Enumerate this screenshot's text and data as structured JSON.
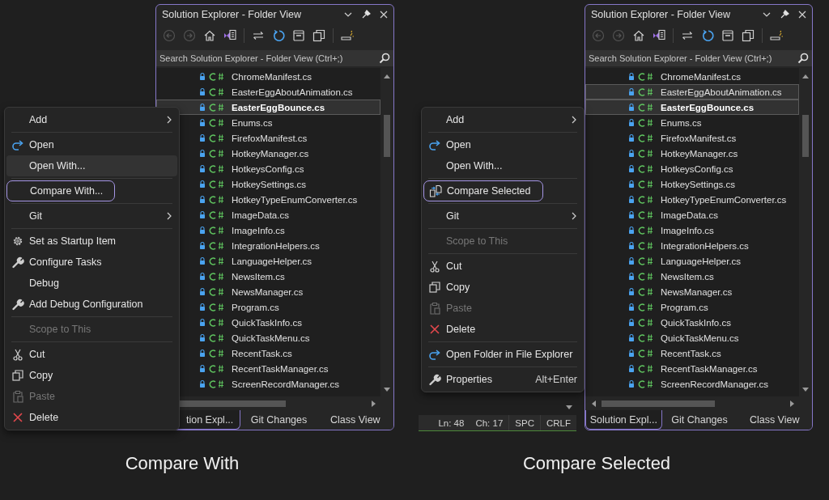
{
  "scenes": [
    {
      "panel": {
        "title": "Solution Explorer - Folder View",
        "search": {
          "placeholder": "Search Solution Explorer - Folder View (Ctrl+;)"
        },
        "files": [
          {
            "name": "ChromeManifest.cs",
            "selected": false,
            "current": false
          },
          {
            "name": "EasterEggAboutAnimation.cs",
            "selected": false,
            "current": false
          },
          {
            "name": "EasterEggBounce.cs",
            "selected": true,
            "current": true
          },
          {
            "name": "Enums.cs",
            "selected": false,
            "current": false
          },
          {
            "name": "FirefoxManifest.cs",
            "selected": false,
            "current": false
          },
          {
            "name": "HotkeyManager.cs",
            "selected": false,
            "current": false
          },
          {
            "name": "HotkeysConfig.cs",
            "selected": false,
            "current": false
          },
          {
            "name": "HotkeySettings.cs",
            "selected": false,
            "current": false
          },
          {
            "name": "HotkeyTypeEnumConverter.cs",
            "selected": false,
            "current": false
          },
          {
            "name": "ImageData.cs",
            "selected": false,
            "current": false
          },
          {
            "name": "ImageInfo.cs",
            "selected": false,
            "current": false
          },
          {
            "name": "IntegrationHelpers.cs",
            "selected": false,
            "current": false
          },
          {
            "name": "LanguageHelper.cs",
            "selected": false,
            "current": false
          },
          {
            "name": "NewsItem.cs",
            "selected": false,
            "current": false
          },
          {
            "name": "NewsManager.cs",
            "selected": false,
            "current": false
          },
          {
            "name": "Program.cs",
            "selected": false,
            "current": false
          },
          {
            "name": "QuickTaskInfo.cs",
            "selected": false,
            "current": false
          },
          {
            "name": "QuickTaskMenu.cs",
            "selected": false,
            "current": false
          },
          {
            "name": "RecentTask.cs",
            "selected": false,
            "current": false
          },
          {
            "name": "RecentTaskManager.cs",
            "selected": false,
            "current": false
          },
          {
            "name": "ScreenRecordManager.cs",
            "selected": false,
            "current": false
          }
        ],
        "tabs": [
          {
            "label": "tion Expl...",
            "selected": true
          },
          {
            "label": "Git Changes",
            "selected": false
          },
          {
            "label": "Class View",
            "selected": false
          }
        ]
      },
      "context_menu": {
        "items": [
          {
            "kind": "item",
            "label": "Add",
            "submenu": true,
            "disabled": false,
            "selected": false,
            "outlined": false
          },
          {
            "kind": "separator"
          },
          {
            "kind": "redo",
            "label": "Open",
            "submenu": false,
            "disabled": false,
            "selected": false,
            "outlined": false
          },
          {
            "kind": "item",
            "label": "Open With...",
            "submenu": false,
            "disabled": false,
            "selected": true,
            "outlined": false
          },
          {
            "kind": "separator"
          },
          {
            "kind": "item",
            "label": "Compare With...",
            "submenu": false,
            "disabled": false,
            "selected": false,
            "outlined": true
          },
          {
            "kind": "separator"
          },
          {
            "kind": "item",
            "label": "Git",
            "submenu": true,
            "disabled": false,
            "selected": false,
            "outlined": false
          },
          {
            "kind": "separator"
          },
          {
            "kind": "gear",
            "label": "Set as Startup Item",
            "submenu": false,
            "disabled": false,
            "selected": false,
            "outlined": false
          },
          {
            "kind": "wrench",
            "label": "Configure Tasks",
            "submenu": false,
            "disabled": false,
            "selected": false,
            "outlined": false
          },
          {
            "kind": "item",
            "label": "Debug",
            "submenu": false,
            "disabled": false,
            "selected": false,
            "outlined": false
          },
          {
            "kind": "wrench",
            "label": "Add Debug Configuration",
            "submenu": false,
            "disabled": false,
            "selected": false,
            "outlined": false
          },
          {
            "kind": "separator"
          },
          {
            "kind": "item",
            "label": "Scope to This",
            "submenu": false,
            "disabled": true,
            "selected": false,
            "outlined": false
          },
          {
            "kind": "separator"
          },
          {
            "kind": "scissors",
            "label": "Cut",
            "submenu": false,
            "disabled": false,
            "selected": false,
            "outlined": false
          },
          {
            "kind": "copy",
            "label": "Copy",
            "submenu": false,
            "disabled": false,
            "selected": false,
            "outlined": false
          },
          {
            "kind": "paste",
            "label": "Paste",
            "submenu": false,
            "disabled": true,
            "selected": false,
            "outlined": false
          },
          {
            "kind": "delete",
            "label": "Delete",
            "submenu": false,
            "disabled": false,
            "selected": false,
            "outlined": false
          }
        ]
      },
      "caption": "Compare With"
    },
    {
      "panel": {
        "title": "Solution Explorer - Folder View",
        "search": {
          "placeholder": "Search Solution Explorer - Folder View (Ctrl+;)"
        },
        "files": [
          {
            "name": "ChromeManifest.cs",
            "selected": false,
            "current": false
          },
          {
            "name": "EasterEggAboutAnimation.cs",
            "selected": true,
            "current": false
          },
          {
            "name": "EasterEggBounce.cs",
            "selected": true,
            "current": true
          },
          {
            "name": "Enums.cs",
            "selected": false,
            "current": false
          },
          {
            "name": "FirefoxManifest.cs",
            "selected": false,
            "current": false
          },
          {
            "name": "HotkeyManager.cs",
            "selected": false,
            "current": false
          },
          {
            "name": "HotkeysConfig.cs",
            "selected": false,
            "current": false
          },
          {
            "name": "HotkeySettings.cs",
            "selected": false,
            "current": false
          },
          {
            "name": "HotkeyTypeEnumConverter.cs",
            "selected": false,
            "current": false
          },
          {
            "name": "ImageData.cs",
            "selected": false,
            "current": false
          },
          {
            "name": "ImageInfo.cs",
            "selected": false,
            "current": false
          },
          {
            "name": "IntegrationHelpers.cs",
            "selected": false,
            "current": false
          },
          {
            "name": "LanguageHelper.cs",
            "selected": false,
            "current": false
          },
          {
            "name": "NewsItem.cs",
            "selected": false,
            "current": false
          },
          {
            "name": "NewsManager.cs",
            "selected": false,
            "current": false
          },
          {
            "name": "Program.cs",
            "selected": false,
            "current": false
          },
          {
            "name": "QuickTaskInfo.cs",
            "selected": false,
            "current": false
          },
          {
            "name": "QuickTaskMenu.cs",
            "selected": false,
            "current": false
          },
          {
            "name": "RecentTask.cs",
            "selected": false,
            "current": false
          },
          {
            "name": "RecentTaskManager.cs",
            "selected": false,
            "current": false
          },
          {
            "name": "ScreenRecordManager.cs",
            "selected": false,
            "current": false
          }
        ],
        "tabs": [
          {
            "label": "Solution Expl...",
            "selected": true
          },
          {
            "label": "Git Changes",
            "selected": false
          },
          {
            "label": "Class View",
            "selected": false
          }
        ]
      },
      "context_menu": {
        "items": [
          {
            "kind": "item",
            "label": "Add",
            "submenu": true,
            "disabled": false,
            "selected": false,
            "outlined": false
          },
          {
            "kind": "separator"
          },
          {
            "kind": "redo",
            "label": "Open",
            "submenu": false,
            "disabled": false,
            "selected": false,
            "outlined": false
          },
          {
            "kind": "item",
            "label": "Open With...",
            "submenu": false,
            "disabled": false,
            "selected": false,
            "outlined": false
          },
          {
            "kind": "separator"
          },
          {
            "kind": "compare",
            "label": "Compare Selected",
            "submenu": false,
            "disabled": false,
            "selected": false,
            "outlined": true
          },
          {
            "kind": "separator"
          },
          {
            "kind": "item",
            "label": "Git",
            "submenu": true,
            "disabled": false,
            "selected": false,
            "outlined": false
          },
          {
            "kind": "separator"
          },
          {
            "kind": "item",
            "label": "Scope to This",
            "submenu": false,
            "disabled": true,
            "selected": false,
            "outlined": false
          },
          {
            "kind": "separator"
          },
          {
            "kind": "scissors",
            "label": "Cut",
            "submenu": false,
            "disabled": false,
            "selected": false,
            "outlined": false
          },
          {
            "kind": "copy",
            "label": "Copy",
            "submenu": false,
            "disabled": false,
            "selected": false,
            "outlined": false
          },
          {
            "kind": "paste",
            "label": "Paste",
            "submenu": false,
            "disabled": true,
            "selected": false,
            "outlined": false
          },
          {
            "kind": "delete",
            "label": "Delete",
            "submenu": false,
            "disabled": false,
            "selected": false,
            "outlined": false
          },
          {
            "kind": "separator"
          },
          {
            "kind": "redo",
            "label": "Open Folder in File Explorer",
            "submenu": false,
            "disabled": false,
            "selected": false,
            "outlined": false
          },
          {
            "kind": "separator"
          },
          {
            "kind": "wrench",
            "label": "Properties",
            "shortcut": "Alt+Enter",
            "submenu": false,
            "disabled": false,
            "selected": false,
            "outlined": false
          }
        ]
      },
      "status_bar": [
        "Ln: 48",
        "Ch: 17",
        "SPC",
        "CRLF"
      ],
      "caption": "Compare Selected"
    }
  ]
}
